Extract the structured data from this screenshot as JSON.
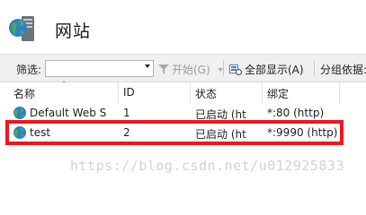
{
  "header": {
    "title": "网站",
    "icon": "sites-server-globe-icon"
  },
  "toolbar": {
    "filter_label": "筛选:",
    "filter_value": "",
    "start_label": "开始(G)",
    "show_all_label": "全部显示(A)",
    "group_by_label": "分组依据:"
  },
  "table": {
    "columns": [
      "名称",
      "ID",
      "状态",
      "绑定"
    ],
    "rows": [
      {
        "name": "Default Web S",
        "id": "1",
        "status": "已启动 (ht",
        "binding": "*:80 (http)"
      },
      {
        "name": "test",
        "id": "2",
        "status": "已启动 (ht",
        "binding": "*:9990 (http)"
      }
    ]
  },
  "watermark": "https://blog.csdn.net/u012925833",
  "colors": {
    "highlight": "#f0151d",
    "toolbar_bg": "#f0f0f0"
  }
}
